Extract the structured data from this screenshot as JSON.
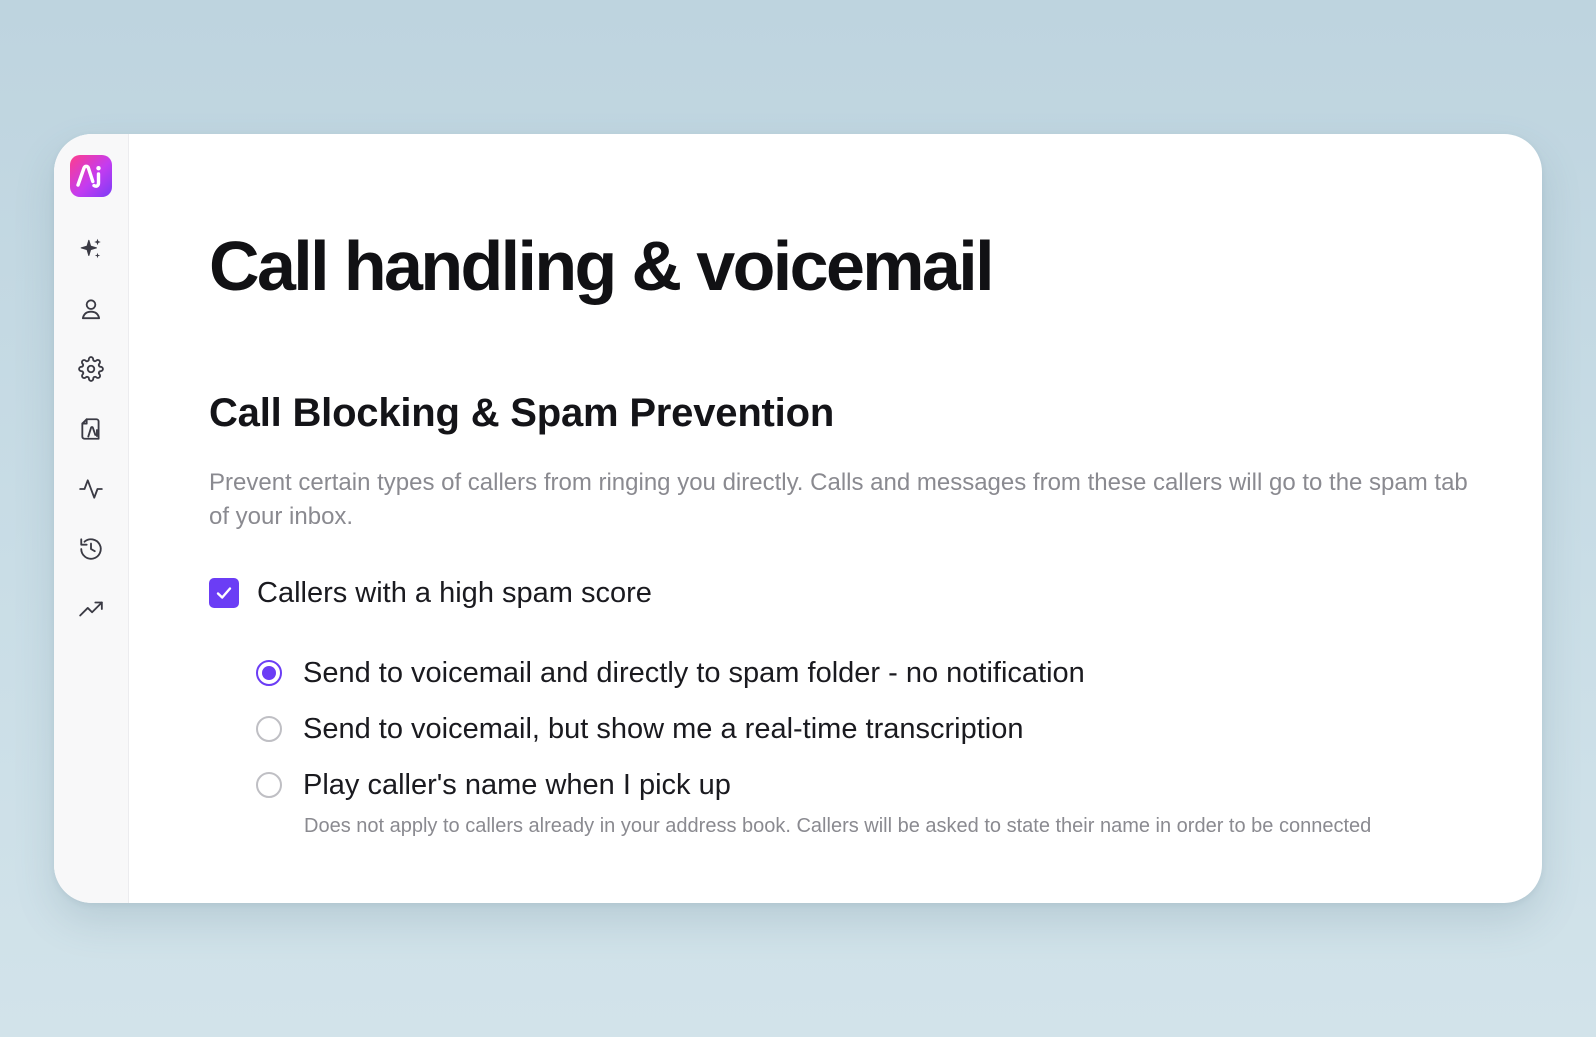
{
  "app": {
    "logo_text": "Ni"
  },
  "sidebar": {
    "items": [
      {
        "icon": "sparkles-icon"
      },
      {
        "icon": "user-icon"
      },
      {
        "icon": "gear-icon"
      },
      {
        "icon": "contacts-icon"
      },
      {
        "icon": "activity-icon"
      },
      {
        "icon": "history-icon"
      },
      {
        "icon": "trending-up-icon"
      }
    ]
  },
  "page": {
    "title": "Call handling & voicemail"
  },
  "section": {
    "title": "Call Blocking & Spam Prevention",
    "description": "Prevent certain types of callers from ringing you directly. Calls and messages from these callers will go to the spam tab of your inbox.",
    "checkbox": {
      "label": "Callers with a high spam score",
      "checked": true
    },
    "options": [
      {
        "label": "Send to voicemail and directly to spam folder - no notification",
        "selected": true
      },
      {
        "label": "Send to voicemail, but show me a real-time transcription",
        "selected": false
      },
      {
        "label": "Play caller's name when I pick up",
        "selected": false,
        "help": "Does not apply to callers already in your address book. Callers will be asked to state their name in order to be connected"
      }
    ]
  },
  "colors": {
    "accent": "#6b3df5",
    "background": "#c9dde6",
    "text_primary": "#111114",
    "text_secondary": "#8a8a90"
  }
}
